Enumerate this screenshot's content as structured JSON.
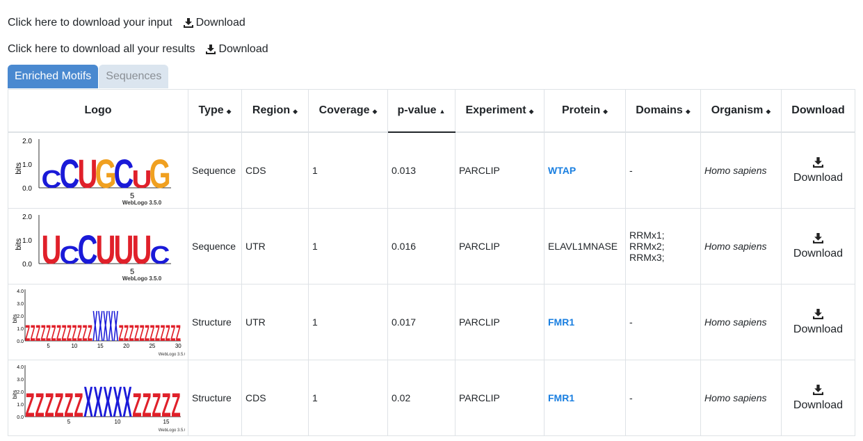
{
  "downloads": {
    "input_text": "Click here to download your input",
    "input_button": "Download",
    "results_text": "Click here to download all your results",
    "results_button": "Download"
  },
  "tabs": [
    {
      "label": "Enriched Motifs",
      "active": true
    },
    {
      "label": "Sequences",
      "active": false
    }
  ],
  "table": {
    "headers": [
      "Logo",
      "Type",
      "Region",
      "Coverage",
      "p-value",
      "Experiment",
      "Protein",
      "Domains",
      "Organism",
      "Download"
    ],
    "rows": [
      {
        "logo": {
          "type": "sequence",
          "letters": "cCUGCuG",
          "tick": "5",
          "credit": "WebLogo 3.5.0",
          "ylabel": "bits",
          "yticks": [
            "2.0",
            "1.0",
            "0.0"
          ]
        },
        "type": "Sequence",
        "region": "CDS",
        "coverage": "1",
        "pvalue": "0.013",
        "experiment": "PARCLIP",
        "protein": "WTAP",
        "protein_link": true,
        "domains": "-",
        "organism": "Homo sapiens",
        "download": "Download"
      },
      {
        "logo": {
          "type": "sequence",
          "letters": "UcCUUUc",
          "tick": "5",
          "credit": "WebLogo 3.5.0",
          "ylabel": "bits",
          "yticks": [
            "2.0",
            "1.0",
            "0.0"
          ]
        },
        "type": "Sequence",
        "region": "UTR",
        "coverage": "1",
        "pvalue": "0.016",
        "experiment": "PARCLIP",
        "protein": "ELAVL1MNASE",
        "protein_link": false,
        "domains": "RRMx1; RRMx2; RRMx3;",
        "organism": "Homo sapiens",
        "download": "Download"
      },
      {
        "logo": {
          "type": "structure",
          "ticks": [
            "5",
            "10",
            "15",
            "20",
            "25",
            "30"
          ],
          "credit": "WebLogo 3.5.0",
          "ylabel": "bits",
          "yticks": [
            "4.0",
            "3.0",
            "2.0",
            "1.0",
            "0.0"
          ]
        },
        "type": "Structure",
        "region": "UTR",
        "coverage": "1",
        "pvalue": "0.017",
        "experiment": "PARCLIP",
        "protein": "FMR1",
        "protein_link": true,
        "domains": "-",
        "organism": "Homo sapiens",
        "download": "Download"
      },
      {
        "logo": {
          "type": "structure",
          "ticks": [
            "5",
            "10",
            "15"
          ],
          "credit": "WebLogo 3.5.0",
          "ylabel": "bits",
          "yticks": [
            "4.0",
            "3.0",
            "2.0",
            "1.0",
            "0.0"
          ]
        },
        "type": "Structure",
        "region": "CDS",
        "coverage": "1",
        "pvalue": "0.02",
        "experiment": "PARCLIP",
        "protein": "FMR1",
        "protein_link": true,
        "domains": "-",
        "organism": "Homo sapiens",
        "download": "Download"
      }
    ]
  },
  "colors": {
    "tab_active": "#4a89d0",
    "tab_inactive": "#dbe5ef",
    "link": "#1a7fe0",
    "logo_red": "#e0202a",
    "logo_blue": "#1a1ad8",
    "logo_orange": "#f0a020",
    "logo_green": "#1a9a2a"
  }
}
